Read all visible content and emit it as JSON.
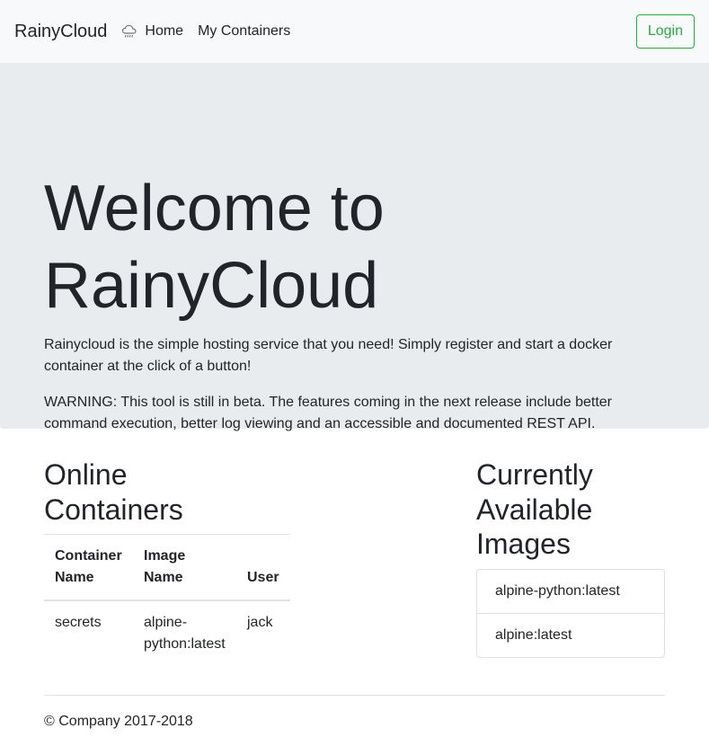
{
  "navbar": {
    "brand": "RainyCloud",
    "home_label": "Home",
    "containers_label": "My Containers",
    "login_label": "Login",
    "home_icon": "cloud-rain-icon"
  },
  "jumbotron": {
    "title": "Welcome to RainyCloud",
    "intro": "Rainycloud is the simple hosting service that you need! Simply register and start a docker container at the click of a button!",
    "warning": "WARNING: This tool is still in beta. The features coming in the next release include better command execution, better log viewing and an accessible and documented REST API."
  },
  "online": {
    "title": "Online Containers",
    "headers": [
      "Container Name",
      "Image Name",
      "User"
    ],
    "rows": [
      [
        "secrets",
        "alpine-python:latest",
        "jack"
      ]
    ]
  },
  "images": {
    "title": "Currently Available Images",
    "items": [
      "alpine-python:latest",
      "alpine:latest"
    ]
  },
  "footer": {
    "text": "© Company 2017-2018"
  },
  "colors": {
    "accent": "#28a745",
    "navbar_bg": "#f8f9fa",
    "jumbotron_bg": "#e9ecef"
  }
}
